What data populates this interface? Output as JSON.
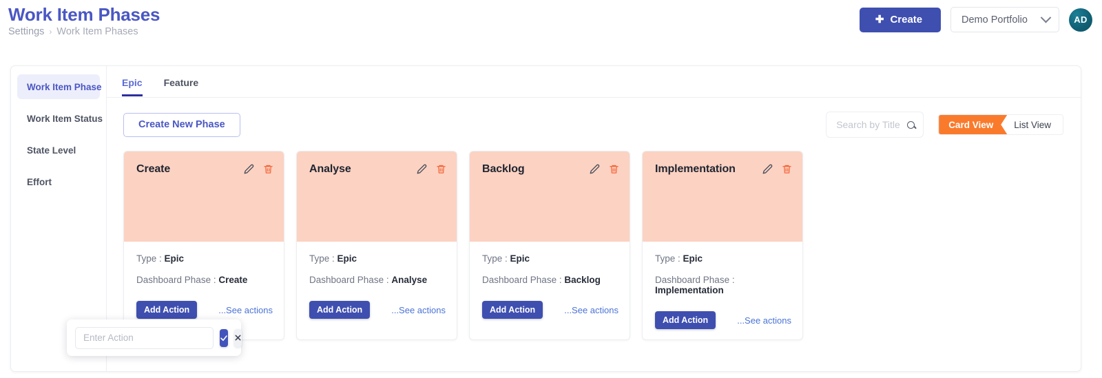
{
  "header": {
    "title": "Work Item Phases",
    "breadcrumb": {
      "root": "Settings",
      "separator": "›",
      "current": "Work Item Phases"
    },
    "create_button": {
      "icon": "plus-icon",
      "label": "Create"
    },
    "portfolio_select": {
      "value": "Demo Portfolio",
      "icon": "chevron-down-icon"
    },
    "avatar": {
      "initials": "AD",
      "color": "#106074"
    }
  },
  "sidebar": {
    "items": [
      {
        "label": "Work Item Phase",
        "active": true
      },
      {
        "label": "Work Item Status",
        "active": false
      },
      {
        "label": "State Level",
        "active": false
      },
      {
        "label": "Effort",
        "active": false
      }
    ]
  },
  "tabs": [
    {
      "label": "Epic",
      "active": true
    },
    {
      "label": "Feature",
      "active": false
    }
  ],
  "toolbar": {
    "create_phase_label": "Create New Phase",
    "search": {
      "placeholder": "Search by Title",
      "value": "",
      "icon": "search-icon"
    },
    "view_toggle": {
      "card_view_label": "Card View",
      "list_view_label": "List View",
      "active": "Card View",
      "active_color": "#fa7a2c"
    }
  },
  "cards": {
    "header_color": "#fcd2c2",
    "type_label": "Type :",
    "dashboard_phase_label": "Dashboard Phase :",
    "add_action_label": "Add Action",
    "see_actions_label": "...See actions",
    "edit_icon": "pencil-icon",
    "delete_icon": "trash-icon",
    "items": [
      {
        "title": "Create",
        "type": "Epic",
        "dashboard_phase": "Create"
      },
      {
        "title": "Analyse",
        "type": "Epic",
        "dashboard_phase": "Analyse"
      },
      {
        "title": "Backlog",
        "type": "Epic",
        "dashboard_phase": "Backlog"
      },
      {
        "title": "Implementation",
        "type": "Epic",
        "dashboard_phase": "Implementation"
      }
    ]
  },
  "action_popup": {
    "input_placeholder": "Enter Action",
    "input_value": "",
    "confirm_icon": "check-icon",
    "cancel_icon": "close-icon"
  }
}
